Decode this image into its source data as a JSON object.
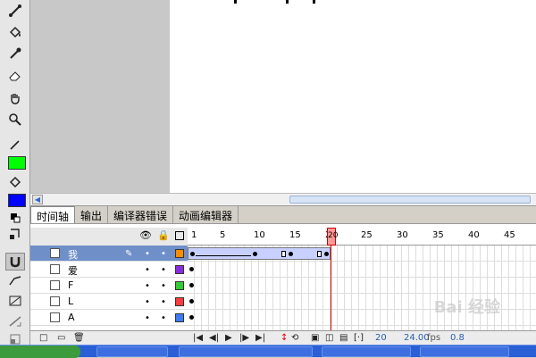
{
  "tabs": [
    {
      "label": "时间轴",
      "active": true
    },
    {
      "label": "输出"
    },
    {
      "label": "编译器错误"
    },
    {
      "label": "动画编辑器"
    }
  ],
  "ruler": [
    "1",
    "5",
    "10",
    "15",
    "20",
    "25",
    "30",
    "35",
    "40",
    "45"
  ],
  "layers": [
    {
      "name": "我",
      "color": "#ff8c00",
      "selected": true
    },
    {
      "name": "爱",
      "color": "#8a2be2"
    },
    {
      "name": "F",
      "color": "#33cc33"
    },
    {
      "name": "L",
      "color": "#ff3b3b"
    },
    {
      "name": "A",
      "color": "#3b7bff"
    }
  ],
  "controls": {
    "current_frame": "20",
    "fps": "24.00",
    "fps_unit": "fps",
    "time": "0.8"
  },
  "tool_colors": {
    "stroke": "#00ff00",
    "fill": "#0000ff"
  },
  "watermark": "Bai 经验"
}
